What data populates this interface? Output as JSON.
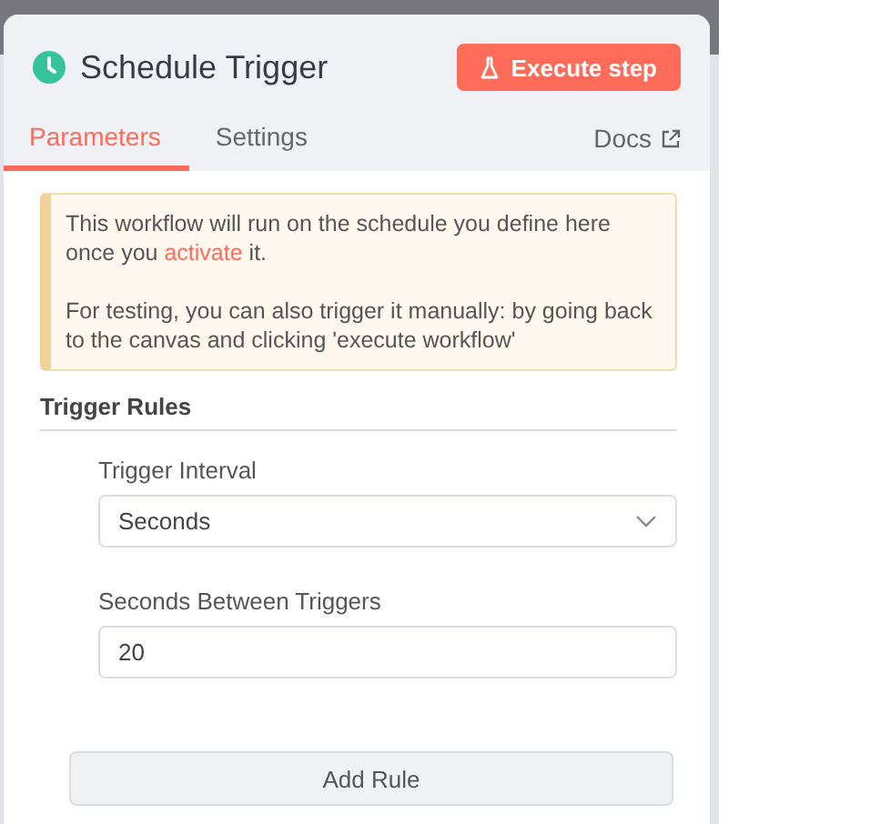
{
  "node": {
    "title": "Schedule Trigger",
    "execute_button": "Execute step"
  },
  "tabs": [
    {
      "label": "Parameters",
      "selected": true
    },
    {
      "label": "Settings",
      "selected": false
    }
  ],
  "docs_link": "Docs",
  "notice": {
    "paragraphs": [
      "This workflow will run on the schedule you define here once you **activate** it.",
      "For testing, you can also trigger it manually: by going back to the canvas and clicking 'execute workflow'"
    ]
  },
  "section_title": "Trigger Rules",
  "fields": [
    {
      "kind": "select",
      "label": "Trigger Interval",
      "value": "Seconds"
    },
    {
      "kind": "number",
      "label": "Seconds Between Triggers",
      "value": "20"
    }
  ],
  "add_button": "Add Rule"
}
